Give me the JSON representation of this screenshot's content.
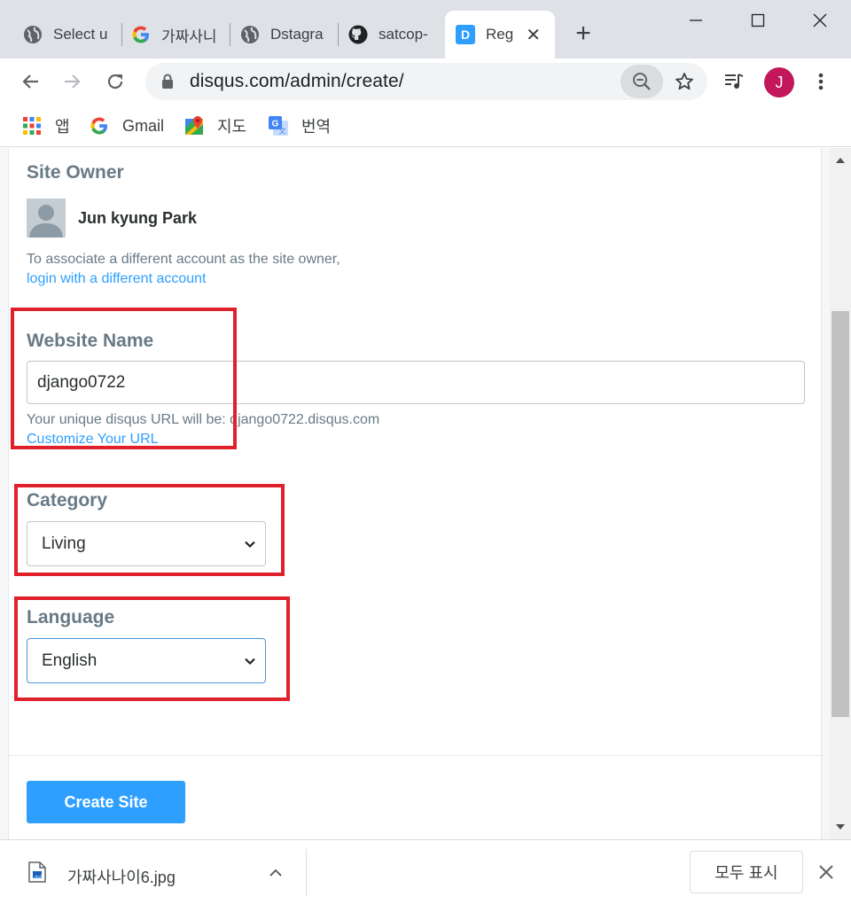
{
  "browser": {
    "tabs": [
      {
        "title": "Select u",
        "icon": "globe-icon"
      },
      {
        "title": "가짜사니",
        "icon": "google-icon"
      },
      {
        "title": "Dstagra",
        "icon": "globe-icon"
      },
      {
        "title": "satcop-",
        "icon": "github-icon"
      },
      {
        "title": "Reg",
        "icon": "disqus-icon",
        "active": true
      }
    ],
    "new_tab_label": "+",
    "address": "disqus.com/admin/create/",
    "avatar_letter": "J",
    "bookmarks": [
      {
        "label": "앱",
        "icon": "apps-grid-icon"
      },
      {
        "label": "Gmail",
        "icon": "google-icon"
      },
      {
        "label": "지도",
        "icon": "maps-icon"
      },
      {
        "label": "번역",
        "icon": "translate-icon"
      }
    ]
  },
  "page": {
    "owner_heading": "Site Owner",
    "owner_name": "Jun kyung Park",
    "associate_text": "To associate a different account as the site owner,",
    "login_link": "login with a different account",
    "website_name_heading": "Website Name",
    "website_name_value": "django0722",
    "url_hint": "Your unique disqus URL will be: django0722.disqus.com",
    "customize_link": "Customize Your URL",
    "category_heading": "Category",
    "category_value": "Living",
    "language_heading": "Language",
    "language_value": "English",
    "create_button": "Create Site"
  },
  "downloads": {
    "file_name": "가짜사나이6.jpg",
    "show_all": "모두 표시"
  },
  "colors": {
    "accent": "#2e9fff",
    "annotation": "#e0202a",
    "avatar": "#c2185b"
  }
}
